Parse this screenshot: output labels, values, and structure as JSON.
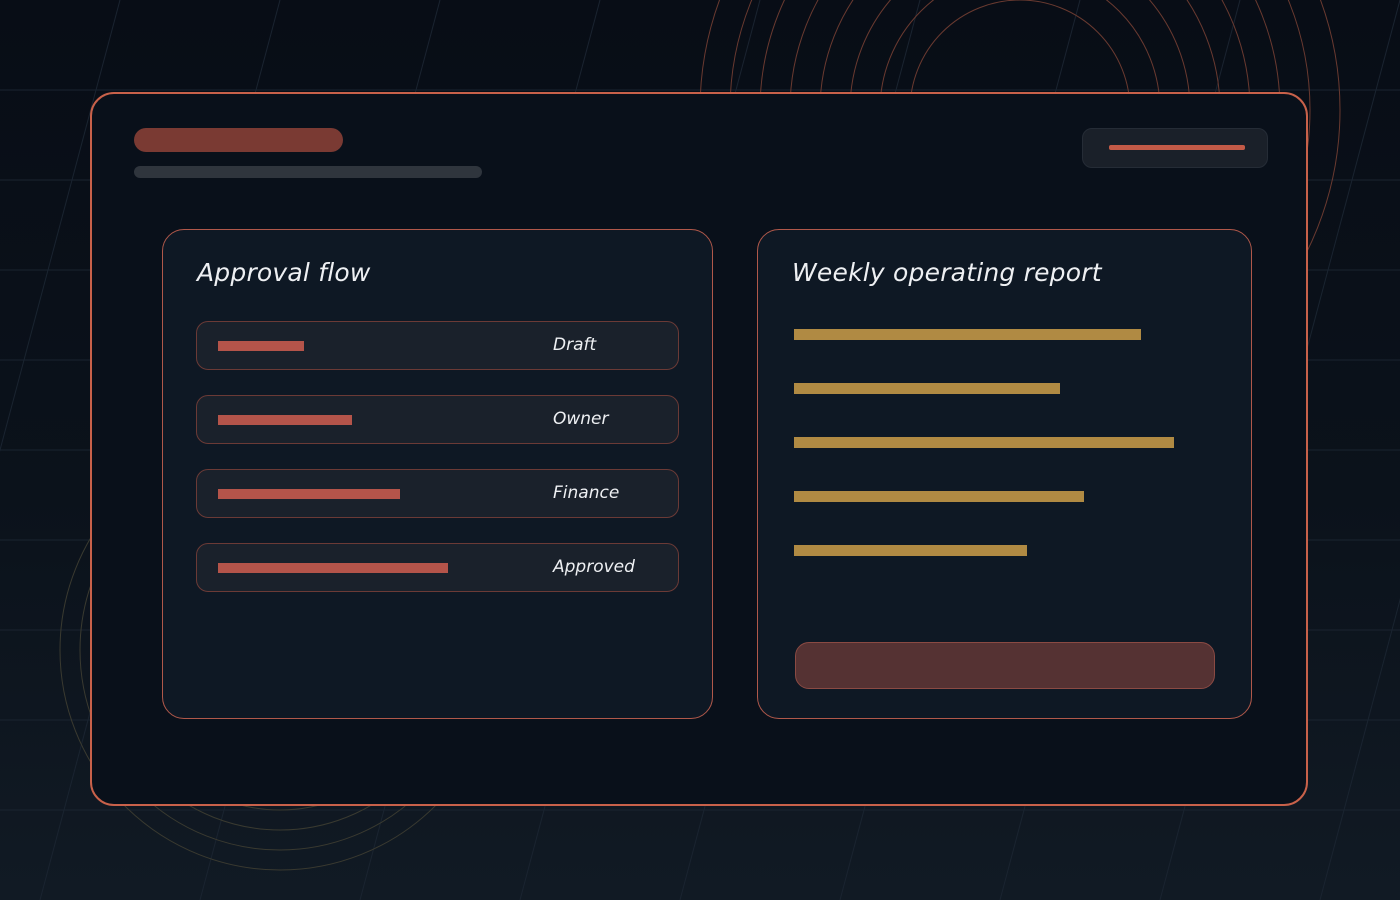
{
  "approval_flow": {
    "title": "Approval flow",
    "steps": [
      {
        "label": "Draft",
        "progress": 0.18
      },
      {
        "label": "Owner",
        "progress": 0.28
      },
      {
        "label": "Finance",
        "progress": 0.38
      },
      {
        "label": "Approved",
        "progress": 0.48
      }
    ]
  },
  "report": {
    "title": "Weekly operating report",
    "bars": [
      0.73,
      0.56,
      0.8,
      0.61,
      0.49
    ]
  },
  "colors": {
    "accent": "#c8614a",
    "step_fill": "#b4544a",
    "report_bar": "#b08a43",
    "report_button": "#553233"
  }
}
